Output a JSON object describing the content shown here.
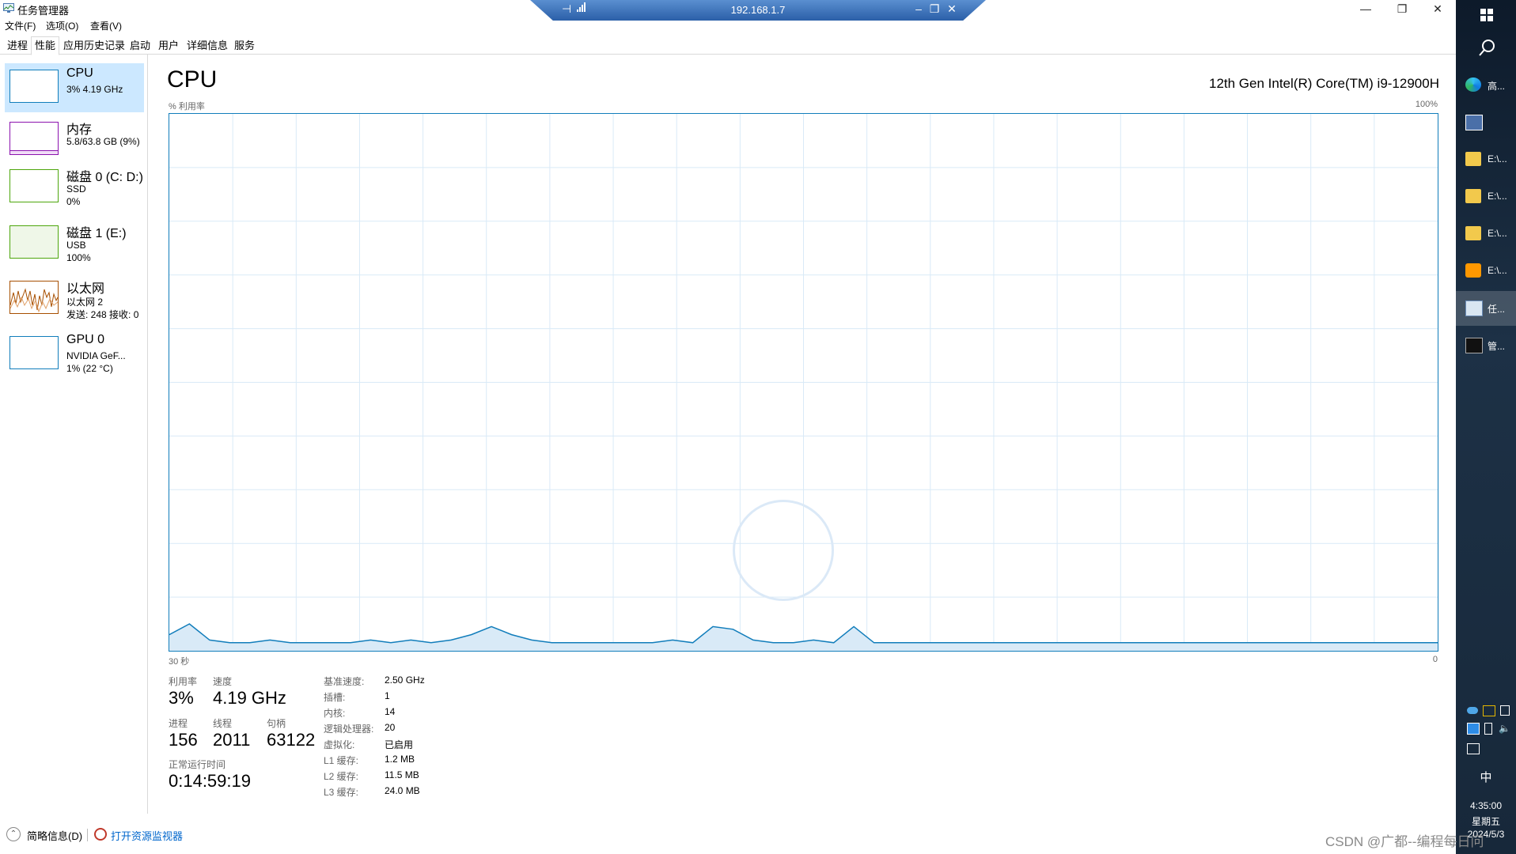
{
  "window": {
    "title": "任务管理器",
    "controls": {
      "minimize": "—",
      "maximize": "❐",
      "close": "✕"
    }
  },
  "rdp": {
    "host": "192.168.1.7",
    "pin": "⊣",
    "minimize": "–",
    "restore": "❐",
    "close": "✕"
  },
  "menu": [
    "文件(F)",
    "选项(O)",
    "查看(V)"
  ],
  "tabs": [
    "进程",
    "性能",
    "应用历史记录",
    "启动",
    "用户",
    "详细信息",
    "服务"
  ],
  "sidebar": [
    {
      "title": "CPU",
      "line1": "3% 4.19 GHz",
      "line2": "",
      "line3": "",
      "color": "#117dbb"
    },
    {
      "title": "内存",
      "line1": "5.8/63.8 GB (9%)",
      "line2": "",
      "line3": "",
      "color": "#8b12ae"
    },
    {
      "title": "磁盘 0 (C: D:)",
      "line1": "SSD",
      "line2": "0%",
      "line3": "",
      "color": "#4da60c"
    },
    {
      "title": "磁盘 1 (E:)",
      "line1": "USB",
      "line2": "100%",
      "line3": "",
      "color": "#4da60c"
    },
    {
      "title": "以太网",
      "line1": "以太网 2",
      "line2": "发送: 248 接收: 0",
      "line3": "",
      "color": "#a74f01"
    },
    {
      "title": "GPU 0",
      "line1": "NVIDIA GeF...",
      "line2": "1% (22 °C)",
      "line3": "",
      "color": "#117dbb"
    }
  ],
  "main": {
    "title": "CPU",
    "model": "12th Gen Intel(R) Core(TM) i9-12900H",
    "y_label": "% 利用率",
    "y_max": "100%",
    "x_left": "30 秒",
    "x_right": "0"
  },
  "stats": {
    "utilization_label": "利用率",
    "utilization": "3%",
    "speed_label": "速度",
    "speed": "4.19 GHz",
    "processes_label": "进程",
    "processes": "156",
    "threads_label": "线程",
    "threads": "2011",
    "handles_label": "句柄",
    "handles": "63122",
    "uptime_label": "正常运行时间",
    "uptime": "0:14:59:19"
  },
  "specs": [
    {
      "label": "基准速度:",
      "value": "2.50 GHz"
    },
    {
      "label": "插槽:",
      "value": "1"
    },
    {
      "label": "内核:",
      "value": "14"
    },
    {
      "label": "逻辑处理器:",
      "value": "20"
    },
    {
      "label": "虚拟化:",
      "value": "已启用"
    },
    {
      "label": "L1 缓存:",
      "value": "1.2 MB"
    },
    {
      "label": "L2 缓存:",
      "value": "11.5 MB"
    },
    {
      "label": "L3 缓存:",
      "value": "24.0 MB"
    }
  ],
  "footer": {
    "brief": "简略信息(D)",
    "open_monitor": "打开资源监视器"
  },
  "taskbar": {
    "items": [
      {
        "label": "高...",
        "icon": "edge-icon"
      },
      {
        "label": "",
        "icon": "notification-app-icon"
      },
      {
        "label": "E:\\...",
        "icon": "folder-icon"
      },
      {
        "label": "E:\\...",
        "icon": "folder-icon"
      },
      {
        "label": "E:\\...",
        "icon": "folder-icon"
      },
      {
        "label": "E:\\...",
        "icon": "sublime-icon"
      },
      {
        "label": "任...",
        "icon": "task-manager-icon"
      },
      {
        "label": "管...",
        "icon": "terminal-icon"
      }
    ],
    "ime": "中",
    "time": "4:35:00",
    "weekday": "星期五",
    "date": "2024/5/3"
  },
  "watermark": "CSDN @广都--编程每日问",
  "chart_data": {
    "type": "area",
    "y_range": [
      0,
      100
    ],
    "x_range": [
      60,
      0
    ],
    "series": [
      {
        "values": [
          3,
          5,
          2,
          1.5,
          1.5,
          2,
          1.5,
          1.5,
          1.5,
          1.5,
          2,
          1.5,
          2,
          1.5,
          2,
          3,
          4.5,
          3,
          2,
          1.5,
          1.5,
          1.5,
          1.5,
          1.5,
          1.5,
          2,
          1.5,
          4.5,
          4,
          2,
          1.5,
          1.5,
          2,
          1.5,
          4.5,
          1.5,
          1.5,
          1.5,
          1.5,
          1.5,
          1.5,
          1.5,
          1.5,
          1.5,
          1.5,
          1.5,
          1.5,
          1.5,
          1.5,
          1.5,
          1.5,
          1.5,
          1.5,
          1.5,
          1.5,
          1.5,
          1.5,
          1.5,
          1.5,
          1.5,
          1.5,
          1.5,
          1.5,
          1.5
        ]
      }
    ]
  }
}
